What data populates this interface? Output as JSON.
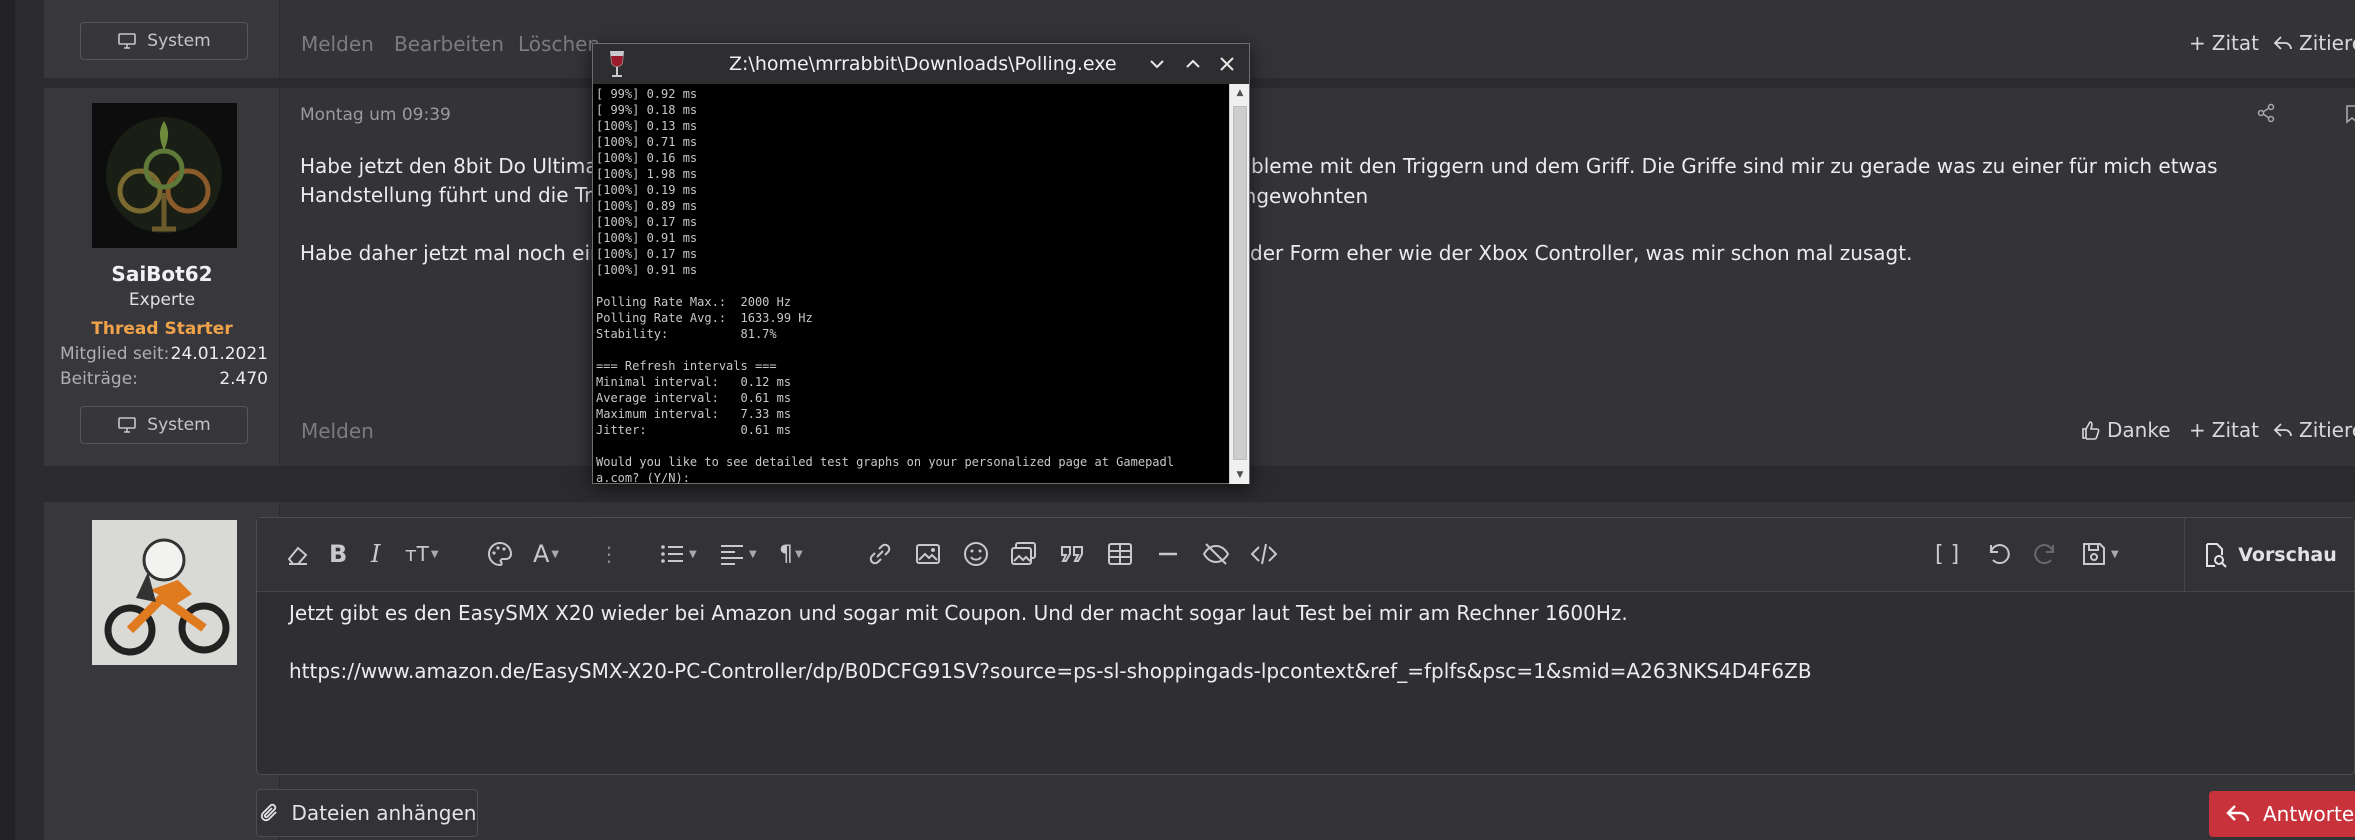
{
  "post1": {
    "system_label": "System",
    "footer_links": [
      "Melden",
      "Bearbeiten",
      "Löschen"
    ],
    "quote_label": "Zitat",
    "cite_label": "Zitiere"
  },
  "post2": {
    "date": "Montag um 09:39",
    "username": "SaiBot62",
    "user_title": "Experte",
    "starter_label": "Thread Starter",
    "member_since_label": "Mitglied seit:",
    "member_since_value": "24.01.2021",
    "posts_label": "Beiträge:",
    "posts_value": "2.470",
    "system_label": "System",
    "text_line1_left": "Habe jetzt den 8bit Do Ultimate",
    "text_line1_right": "robleme mit den Triggern und dem Griff. Die Griffe sind mir zu gerade was zu einer für mich etwas ungewohnten",
    "text_line2_left": "Handstellung führt und die Trig",
    "text_line3_left": "Habe daher jetzt mal noch eine",
    "text_line3_right": "n der Form eher wie der Xbox Controller, was mir schon mal zusagt.",
    "report_label": "Melden",
    "thanks_label": "Danke",
    "quote_label": "Zitat",
    "cite_label": "Zitiere",
    "post_number": "#"
  },
  "editor": {
    "line1": "Jetzt gibt es den EasySMX X20 wieder bei Amazon und sogar mit Coupon. Und der macht sogar laut Test bei mir am Rechner 1600Hz.",
    "line2": "https://www.amazon.de/EasySMX-X20-PC-Controller/dp/B0DCFG91SV?source=ps-sl-shoppingads-lpcontext&ref_=fplfs&psc=1&smid=A263NKS4D4F6ZB",
    "preview_label": "Vorschau",
    "attach_label": "Dateien anhängen",
    "reply_label": "Antworten"
  },
  "console_window": {
    "title": "Z:\\home\\mrrabbit\\Downloads\\Polling.exe",
    "lines": [
      "[ 99%] 0.92 ms",
      "[ 99%] 0.18 ms",
      "[100%] 0.13 ms",
      "[100%] 0.71 ms",
      "[100%] 0.16 ms",
      "[100%] 1.98 ms",
      "[100%] 0.19 ms",
      "[100%] 0.89 ms",
      "[100%] 0.17 ms",
      "[100%] 0.91 ms",
      "[100%] 0.17 ms",
      "[100%] 0.91 ms",
      "",
      "Polling Rate Max.:  2000 Hz",
      "Polling Rate Avg.:  1633.99 Hz",
      "Stability:          81.7%",
      "",
      "=== Refresh intervals ===",
      "Minimal interval:   0.12 ms",
      "Average interval:   0.61 ms",
      "Maximum interval:   7.33 ms",
      "Jitter:             0.61 ms",
      "",
      "Would you like to see detailed test graphs on your personalized page at Gamepadl",
      "a.com? (Y/N): _"
    ]
  }
}
